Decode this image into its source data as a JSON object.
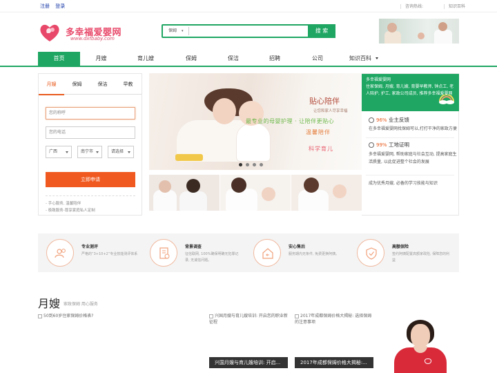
{
  "topbar": {
    "register": "注册",
    "login": "登录",
    "hotline": "咨询热线:",
    "knowledge": "知识百科"
  },
  "brand": {
    "name": "多幸福爱婴网",
    "url": "www.dxfbaby.com"
  },
  "search": {
    "category": "保姆",
    "placeholder": "",
    "button": "搜 索"
  },
  "nav": {
    "items": [
      "首页",
      "月嫂",
      "育儿嫂",
      "保姆",
      "保洁",
      "招聘",
      "公司",
      "知识百科"
    ]
  },
  "form": {
    "tabs": [
      "月嫂",
      "保姆",
      "保洁",
      "早教"
    ],
    "name_placeholder": "您的称呼",
    "phone_placeholder": "您的电话",
    "province": "广西",
    "city": "南宁市",
    "district": "请选择",
    "submit": "立即申请",
    "notes": [
      "- 手心服务, 温馨陪伴",
      "- 极致服务-尊享家庭私人定制"
    ]
  },
  "slider": {
    "title": "贴心陪伴",
    "subtitle": "让您和家人尽享幸福",
    "line1": "最专业的母婴护理 · 让陪伴更贴心",
    "line2": "温馨陪伴",
    "line3": "科学育儿"
  },
  "panel": {
    "head": "多幸福爱婴网\n住家保姆, 月嫂, 育儿嫂, 育婴早教师, 钟点工, 老人陪护, 护工, 家政公司成员, 推荐多幸福爱婴网",
    "stat1_pct": "96%",
    "stat1_label": "业主反馈",
    "stat1_desc": "在多幸福爱婴网找保姆可以,打打干净的家政方便",
    "stat2_pct": "99%",
    "stat2_label": "工地证明",
    "stat2_desc": "多幸福爱婴网, 帮助家庭与社会互动, 提高家庭生活质量, 以此促进整个社会的发展",
    "footer": "成为优秀月嫂, 必备的学习技能与知识"
  },
  "features": [
    {
      "title": "专业测评",
      "desc": "严格的“3+10+2”专业技能测评体系"
    },
    {
      "title": "背景调查",
      "desc": "征信联网, 100%确保明确无犯罪记录, 无诚信问题。"
    },
    {
      "title": "安心售后",
      "desc": "服务期内无条件, 免费更换阿姨。"
    },
    {
      "title": "高额保险",
      "desc": "签约阿姨配置高额家政险, 保障您的利益"
    }
  ],
  "section": {
    "title": "月嫂",
    "subtitle": "家政保姆 用心服务"
  },
  "articles": [
    {
      "caption": "50到60岁住家保姆价格表?",
      "bar": ""
    },
    {
      "caption": "兴国月嫂与育儿嫂培训: 开启您的职业新征程",
      "bar": "兴国月嫂与育儿嫂培训: 开启..."
    },
    {
      "caption": "2017年成都保姆价格大揭秘: 选择保姆的注意事项",
      "bar": "2017年成都保姆价格大揭秘:..."
    }
  ],
  "colors": {
    "brand_green": "#1ea662",
    "accent_orange": "#f0591f",
    "logo_pink": "#e8496a"
  }
}
